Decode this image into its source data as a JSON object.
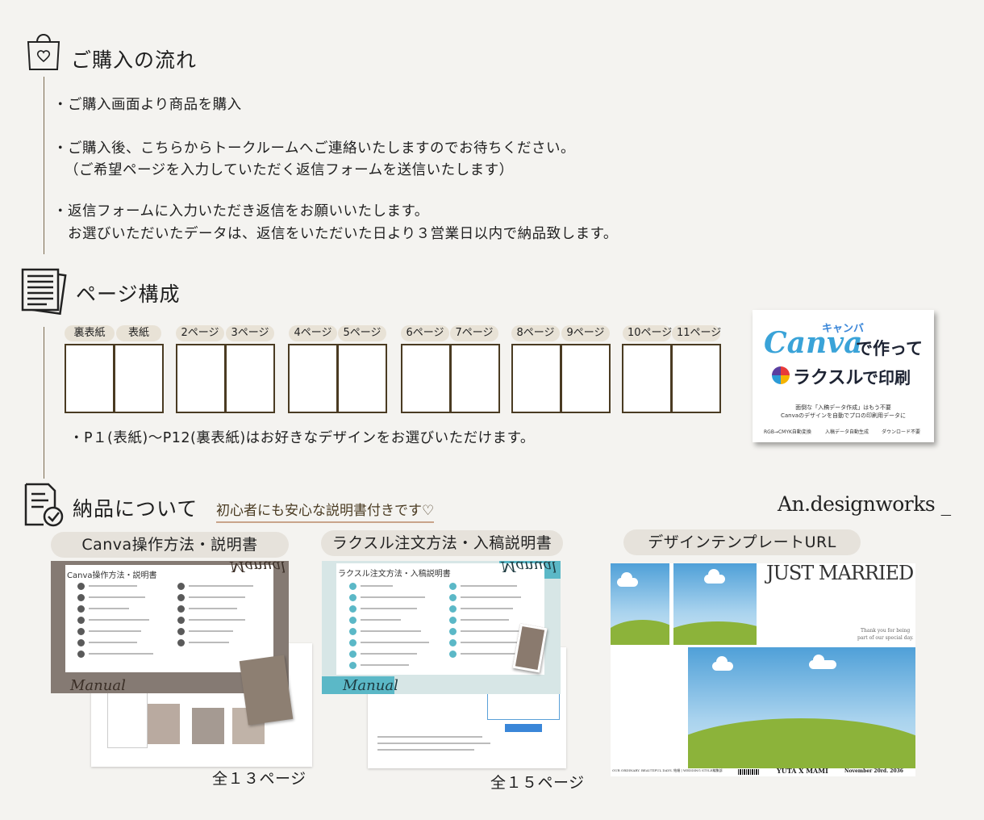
{
  "sections": {
    "purchase": {
      "title": "ご購入の流れ",
      "lines": [
        "・ご購入画面より商品を購入",
        "・ご購入後、こちらからトークルームへご連絡いたしますのでお待ちください。",
        "（ご希望ページを入力していただく返信フォームを送信いたします）",
        "・返信フォームに入力いただき返信をお願いいたします。",
        "お選びいただいたデータは、返信をいただいた日より３営業日以内で納品致します。"
      ]
    },
    "pages": {
      "title": "ページ構成",
      "labels": [
        "裏表紙",
        "表紙",
        "2ページ",
        "3ページ",
        "4ページ",
        "5ページ",
        "6ページ",
        "7ページ",
        "8ページ",
        "9ページ",
        "10ページ",
        "11ページ"
      ],
      "note": "・P１(表紙)〜P12(裏表紙)はお好きなデザインをお選びいただけます。"
    },
    "delivery": {
      "title": "納品について",
      "subtitle": "初心者にも安心な説明書付きです♡",
      "brand": "An.designworks _",
      "cards": [
        {
          "label": "Canva操作方法・説明書",
          "doc_title": "Canva操作方法・説明書",
          "manual": "Manual",
          "count": "全１３ページ"
        },
        {
          "label": "ラクスル注文方法・入稿説明書",
          "doc_title": "ラクスル注文方法・入稿説明書",
          "manual": "Manual",
          "count": "全１５ページ"
        },
        {
          "label": "デザインテンプレートURL"
        }
      ]
    }
  },
  "canva_ad": {
    "kana": "キャンバ",
    "brand": "Canva",
    "line1": "で作って",
    "print_brand": "ラクスル",
    "line2": "で印刷",
    "desc1": "面倒な「入稿データ作成」はもう不要",
    "desc2": "Canvaのデザインを自動でプロの印刷用データに",
    "features": [
      "RGB→CMYK自動変換",
      "入稿データ自動生成",
      "ダウンロード不要"
    ]
  },
  "template": {
    "headline": "JUST MARRIED",
    "thanks1": "Thank you for being",
    "thanks2": "part of our special day.",
    "footer_left": "OUR ORDINARY. BEAUTIFUL DAYS. 結婚 | WEDDING STYLE編集部",
    "names": "YUTA X MAMI",
    "date": "November 20rd. 2036"
  },
  "colors": {
    "background": "#f4f3f0",
    "frame": "#4a3b22",
    "accent_underline": "#c9a48a",
    "teal": "#5bb8c7"
  }
}
